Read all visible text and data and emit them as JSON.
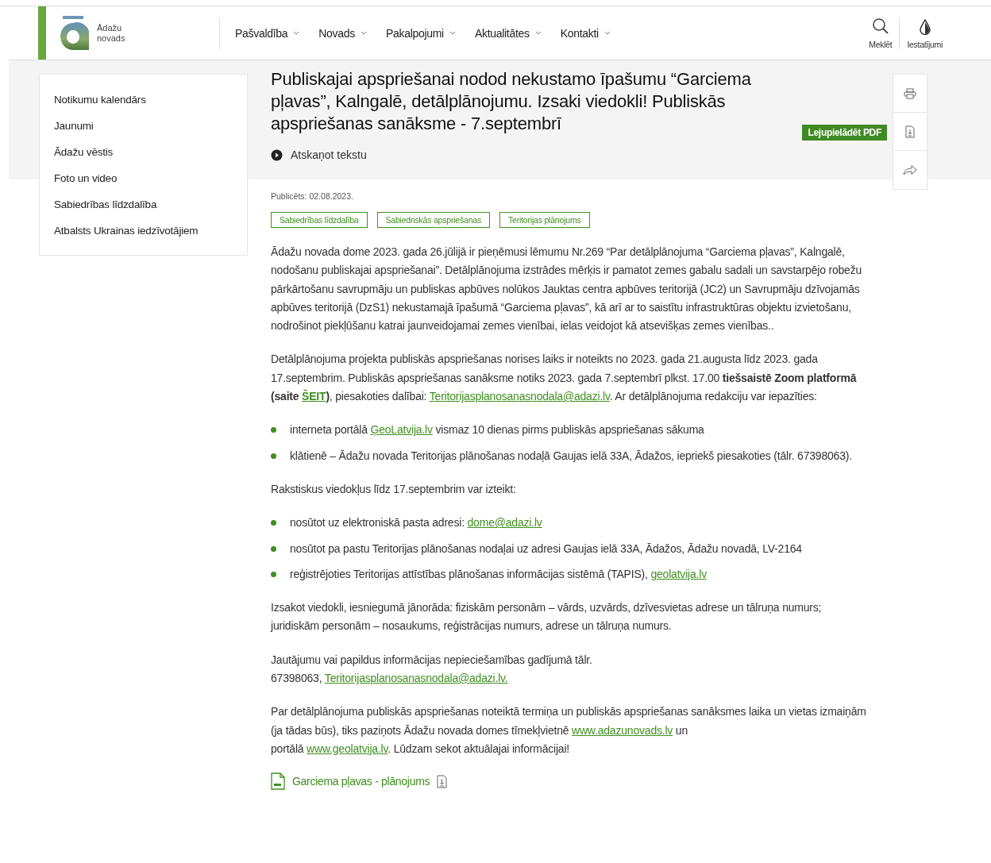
{
  "header": {
    "logo_lines": [
      "Ādažu",
      "novads"
    ],
    "nav": [
      {
        "label": "Pašvaldība"
      },
      {
        "label": "Novads"
      },
      {
        "label": "Pakalpojumi"
      },
      {
        "label": "Aktualitātes"
      },
      {
        "label": "Kontakti"
      }
    ],
    "tools": [
      {
        "kind": "search",
        "label": "Meklēt"
      },
      {
        "kind": "settings",
        "label": "Iestatījumi"
      }
    ]
  },
  "sidebar": {
    "items": [
      "Notikumu kalendārs",
      "Jaunumi",
      "Ādažu vēstis",
      "Foto un video",
      "Sabiedrības līdzdalība",
      "Atbalsts Ukrainas iedzīvotājiem"
    ]
  },
  "article": {
    "title": "Publiskajai apspriešanai nodod nekustamo īpašumu “Garciema pļavas”, Kalngalē, detālplānojumu. Izsaki viedokli! Publiskās apspriešanas sanāksme - 7.septembrī",
    "play_label": "Atskaņot tekstu",
    "published": "Publicēts: 02.08.2023.",
    "tags": [
      "Sabiedrības līdzdalība",
      "Sabiedriskās apspriešanas",
      "Teritorijas plānojums"
    ],
    "body": [
      {
        "kind": "paragraph",
        "segments": [
          {
            "kind": "text",
            "text": "Ādažu novada dome 2023. gada 26.jūlijā ir pieņēmusi lēmumu Nr.269 “Par detālplānojuma “Garciema pļavas”, Kalngalē, nodošanu publiskajai apspriešanai”. Detālplānojuma izstrādes mērķis ir pamatot zemes gabalu sadali un savstarpējo robežu pārkārtošanu savrupmāju un publiskas apbūves nolūkos Jauktas centra apbūves teritorijā (JC2) un Savrupmāju dzīvojamās apbūves teritorijā (DzS1) nekustamajā īpašumā “Garciema pļavas”, kā arī ar to saistītu infrastruktūras objektu izvietošanu, nodrošinot piekļūšanu katrai jaunveidojamai zemes vienībai, ielas veidojot kā atsevišķas zemes vienības.."
          }
        ]
      },
      {
        "kind": "paragraph",
        "segments": [
          {
            "kind": "text",
            "text": "Detālplānojuma projekta publiskās apspriešanas norises laiks ir noteikts no 2023. gada 21.augusta līdz 2023. gada 17.septembrim. Publiskās apspriešanas sanāksme notiks 2023. gada 7.septembrī plkst. 17.00 "
          },
          {
            "kind": "bold",
            "text": "tiešsaistē Zoom platformā (saite "
          },
          {
            "kind": "boldlink",
            "text": "ŠEIT"
          },
          {
            "kind": "bold",
            "text": ")"
          },
          {
            "kind": "text",
            "text": ", piesakoties dalībai: "
          },
          {
            "kind": "link",
            "text": "Teritorijasplanosanasnodala@adazi.lv"
          },
          {
            "kind": "text",
            "text": ". Ar detālplānojuma redakciju var iepazīties:"
          }
        ]
      },
      {
        "kind": "bullets",
        "items": [
          [
            {
              "kind": "text",
              "text": "interneta portālā "
            },
            {
              "kind": "link",
              "text": "ĢeoLatvija.lv"
            },
            {
              "kind": "text",
              "text": " vismaz 10 dienas pirms publiskās apspriešanas sākuma"
            }
          ],
          [
            {
              "kind": "text",
              "text": "klātienē – Ādažu novada Teritorijas plānošanas nodaļā Gaujas ielā 33A, Ādažos, iepriekš piesakoties (tālr. 67398063)."
            }
          ]
        ]
      },
      {
        "kind": "paragraph",
        "segments": [
          {
            "kind": "text",
            "text": "Rakstiskus viedokļus līdz 17.septembrim var izteikt:"
          }
        ]
      },
      {
        "kind": "bullets",
        "items": [
          [
            {
              "kind": "text",
              "text": "nosūtot uz elektroniskā pasta adresi: "
            },
            {
              "kind": "link",
              "text": "dome@adazi.lv"
            }
          ],
          [
            {
              "kind": "text",
              "text": "nosūtot pa pastu Teritorijas plānošanas nodaļai uz adresi Gaujas ielā 33A, Ādažos, Ādažu novadā, LV-2164"
            }
          ],
          [
            {
              "kind": "text",
              "text": "reģistrējoties Teritorijas attīstības plānošanas informācijas sistēmā (TAPIS), "
            },
            {
              "kind": "link",
              "text": "geolatvija.lv"
            }
          ]
        ]
      },
      {
        "kind": "paragraph",
        "segments": [
          {
            "kind": "text",
            "text": "Izsakot viedokli, iesniegumā jānorāda: fiziskām personām – vārds, uzvārds, dzīvesvietas adrese un tālruņa numurs; juridiskām personām – nosaukums, reģistrācijas numurs, adrese un tālruņa numurs."
          }
        ]
      },
      {
        "kind": "paragraph",
        "segments": [
          {
            "kind": "text",
            "text": "Jautājumu vai papildus informācijas nepieciešamības gadījumā  tālr.\n 67398063, "
          },
          {
            "kind": "link",
            "text": "Teritorijasplanosanasnodala@adazi.lv."
          }
        ]
      },
      {
        "kind": "paragraph",
        "segments": [
          {
            "kind": "text",
            "text": "Par detālplānojuma publiskās apspriešanas noteiktā termiņa un publiskās apspriešanas sanāksmes laika un vietas izmaiņām (ja tādas būs), tiks paziņots Ādažu novada domes tīmekļvietnē "
          },
          {
            "kind": "link",
            "text": "www.adazunovads.lv"
          },
          {
            "kind": "text",
            "text": " un\nportālā "
          },
          {
            "kind": "link",
            "text": "www.geolatvija.lv"
          },
          {
            "kind": "text",
            "text": ". Lūdzam sekot aktuālajai informācijai!"
          }
        ]
      }
    ],
    "attachment": {
      "label": "Garciema pļavas - plānojums"
    }
  },
  "actions": {
    "buttons": [
      {
        "kind": "print"
      },
      {
        "kind": "pdf"
      },
      {
        "kind": "share"
      }
    ],
    "tooltip": "Lejupielādēt PDF"
  }
}
